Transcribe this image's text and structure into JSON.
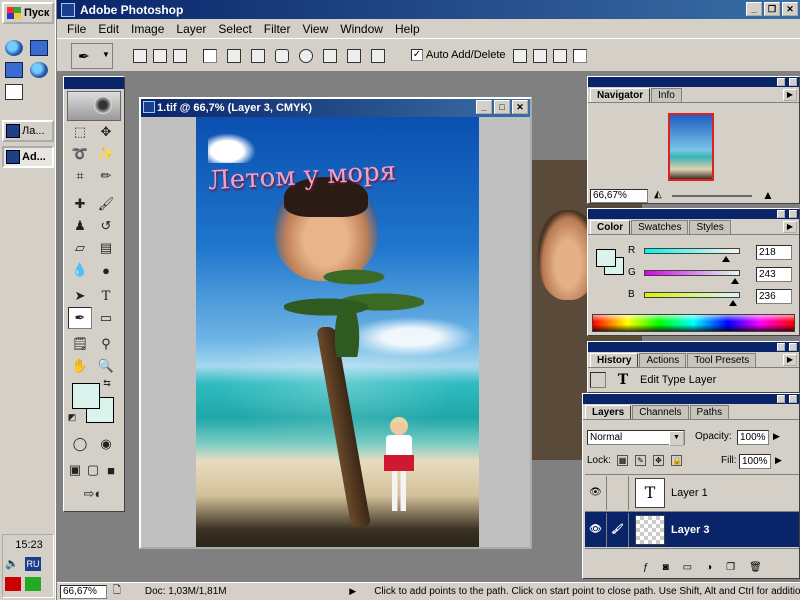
{
  "taskbar": {
    "start_label": "Пуск",
    "tasks": [
      {
        "label": "Ла...",
        "active": false
      },
      {
        "label": "Ad...",
        "active": true
      }
    ],
    "clock": "15:23",
    "lang": "RU"
  },
  "app": {
    "title": "Adobe Photoshop",
    "menu": [
      "File",
      "Edit",
      "Image",
      "Layer",
      "Select",
      "Filter",
      "View",
      "Window",
      "Help"
    ],
    "options": {
      "auto_add_label": "Auto Add/Delete",
      "auto_add_checked": "✓"
    }
  },
  "document": {
    "title": "1.tif @ 66,7% (Layer 3, CMYK)",
    "photo_text": "Летом у моря"
  },
  "navigator": {
    "tabs": [
      "Navigator",
      "Info"
    ],
    "zoom": "66,67%"
  },
  "color": {
    "tabs": [
      "Color",
      "Swatches",
      "Styles"
    ],
    "r_label": "R",
    "r_value": "218",
    "g_label": "G",
    "g_value": "243",
    "b_label": "B",
    "b_value": "236",
    "foreground_hex": "#daf3ec"
  },
  "history": {
    "tabs": [
      "History",
      "Actions",
      "Tool Presets"
    ],
    "items": [
      {
        "label": "Edit Type Layer",
        "icon": "type-layer-icon"
      }
    ]
  },
  "layers": {
    "tabs": [
      "Layers",
      "Channels",
      "Paths"
    ],
    "blend_mode": "Normal",
    "opacity_label": "Opacity:",
    "opacity": "100%",
    "lock_label": "Lock:",
    "fill_label": "Fill:",
    "fill": "100%",
    "items": [
      {
        "name": "Layer 1",
        "thumb": "T",
        "selected": false
      },
      {
        "name": "Layer 3",
        "thumb": "",
        "selected": true
      }
    ]
  },
  "statusbar": {
    "zoom": "66,67%",
    "doc": "Doc: 1,03M/1,81M",
    "hint": "Click to add points to the path.  Click on start point to close path.  Use Shift, Alt and Ctrl for additiona"
  }
}
